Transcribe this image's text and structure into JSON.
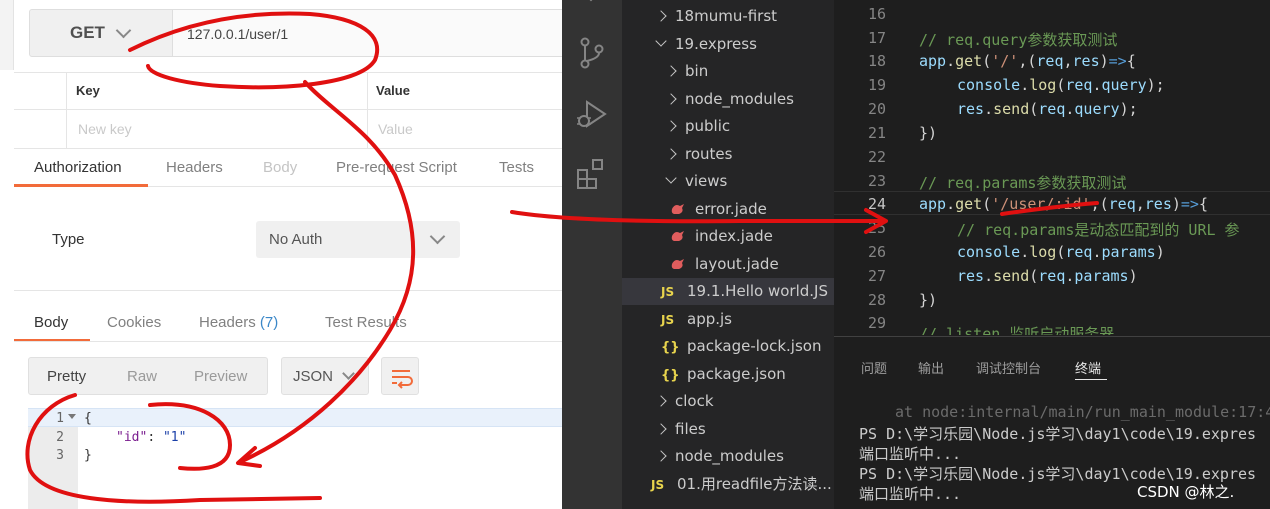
{
  "postman": {
    "method": "GET",
    "url": "127.0.0.1/user/1",
    "params_table": {
      "key_header": "Key",
      "value_header": "Value",
      "key_placeholder": "New key",
      "value_placeholder": "Value"
    },
    "request_tabs": [
      "Authorization",
      "Headers",
      "Body",
      "Pre-request Script",
      "Tests"
    ],
    "auth": {
      "type_label": "Type",
      "type_value": "No Auth"
    },
    "response_tabs": {
      "body": "Body",
      "cookies": "Cookies",
      "headers": "Headers",
      "headers_count": "(7)",
      "test_results": "Test Results"
    },
    "format_buttons": [
      "Pretty",
      "Raw",
      "Preview"
    ],
    "format_select": "JSON",
    "response_body": {
      "line_numbers": [
        "1",
        "2",
        "3"
      ],
      "line1": "{",
      "key": "\"id\"",
      "colon": ": ",
      "value": "\"1\"",
      "line3": "}"
    }
  },
  "vscode": {
    "explorer": [
      {
        "label": "18mumu-first",
        "kind": "folder-collapsed"
      },
      {
        "label": "19.express",
        "kind": "folder-expanded"
      },
      {
        "label": "bin",
        "kind": "folder-collapsed"
      },
      {
        "label": "node_modules",
        "kind": "folder-collapsed"
      },
      {
        "label": "public",
        "kind": "folder-collapsed"
      },
      {
        "label": "routes",
        "kind": "folder-collapsed"
      },
      {
        "label": "views",
        "kind": "folder-expanded"
      },
      {
        "label": "error.jade",
        "kind": "jade"
      },
      {
        "label": "index.jade",
        "kind": "jade"
      },
      {
        "label": "layout.jade",
        "kind": "jade"
      },
      {
        "label": "19.1.Hello world.JS",
        "kind": "js"
      },
      {
        "label": "app.js",
        "kind": "js"
      },
      {
        "label": "package-lock.json",
        "kind": "json"
      },
      {
        "label": "package.json",
        "kind": "json"
      },
      {
        "label": "clock",
        "kind": "folder-collapsed"
      },
      {
        "label": "files",
        "kind": "folder-collapsed"
      },
      {
        "label": "node_modules",
        "kind": "folder-collapsed"
      },
      {
        "label": "01.用readfile方法读...",
        "kind": "js"
      }
    ],
    "icon_labels": {
      "js": "JS",
      "json": "{}"
    },
    "line_numbers": [
      "16",
      "17",
      "18",
      "19",
      "20",
      "21",
      "22",
      "23",
      "24",
      "25",
      "26",
      "27",
      "28",
      "29"
    ],
    "code": {
      "l17": "// req.query参数获取测试",
      "l23": "// req.params参数获取测试",
      "l25": "// req.params是动态匹配到的 URL 参",
      "l29": "// listen 监听启动服务器",
      "app": "app",
      "get": "get",
      "str_root": "'/'",
      "str_user": "'/user/:id'",
      "req": "req",
      "res": "res",
      "arrow": "=>",
      "console": "console",
      "log": "log",
      "send": "send",
      "query": "query",
      "params": "params"
    },
    "panel_tabs": [
      "问题",
      "输出",
      "调试控制台",
      "终端"
    ],
    "terminal": [
      "at node:internal/main/run_main_module:17:4",
      "PS D:\\学习乐园\\Node.js学习\\day1\\code\\19.expres",
      "端口监听中...",
      "PS D:\\学习乐园\\Node.js学习\\day1\\code\\19.expres",
      "端口监听中..."
    ]
  },
  "watermark": "CSDN @林之."
}
